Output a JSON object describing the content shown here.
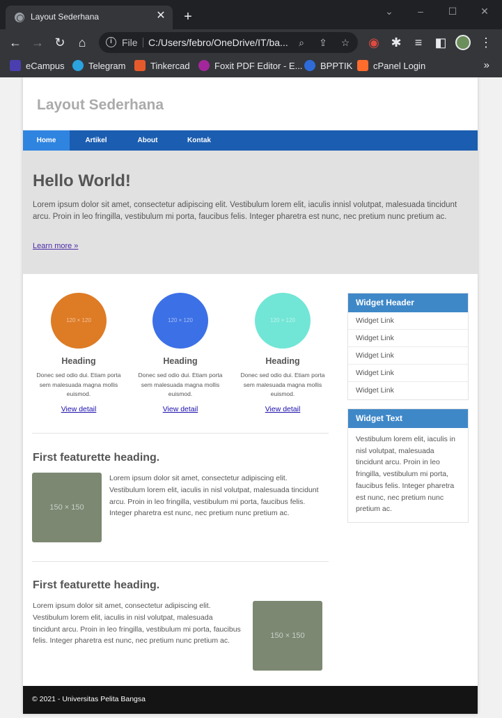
{
  "browser": {
    "tab_title": "Layout Sederhana",
    "new_tab": "+",
    "tab_close": "✕",
    "omnibox": {
      "scheme_label": "File",
      "url": "C:/Users/febro/OneDrive/IT/ba..."
    },
    "bookmarks": [
      {
        "label": "eCampus",
        "color": "#4b3fb0"
      },
      {
        "label": "Telegram",
        "color": "#2aa3de"
      },
      {
        "label": "Tinkercad",
        "color": "#e55a2b"
      },
      {
        "label": "Foxit PDF Editor - E...",
        "color": "#a3279b"
      },
      {
        "label": "BPPTIK",
        "color": "#2f6bd8"
      },
      {
        "label": "cPanel Login",
        "color": "#ff6c2c"
      }
    ],
    "bookmarks_more": "»"
  },
  "site": {
    "title": "Layout Sederhana",
    "nav": [
      "Home",
      "Artikel",
      "About",
      "Kontak"
    ]
  },
  "hero": {
    "title": "Hello World!",
    "text": "Lorem ipsum dolor sit amet, consectetur adipiscing elit. Vestibulum lorem elit, iaculis innisl volutpat, malesuada tincidunt arcu. Proin in leo fringilla, vestibulum mi porta, faucibus felis. Integer pharetra est nunc, nec pretium nunc pretium ac.",
    "link": "Learn more »"
  },
  "cards": [
    {
      "placeholder": "120 × 120",
      "color": "#de7b25",
      "heading": "Heading",
      "text": "Donec sed odio dui. Etiam porta sem malesuada magna mollis euismod.",
      "link": "View detail"
    },
    {
      "placeholder": "120 × 120",
      "color": "#3c70e6",
      "heading": "Heading",
      "text": "Donec sed odio dui. Etiam porta sem malesuada magna mollis euismod.",
      "link": "View detail"
    },
    {
      "placeholder": "120 × 120",
      "color": "#71e6d6",
      "heading": "Heading",
      "text": "Donec sed odio dui. Etiam porta sem malesuada magna mollis euismod.",
      "link": "View detail"
    }
  ],
  "featurettes": [
    {
      "heading": "First featurette heading.",
      "image": "150 × 150",
      "text": "Lorem ipsum dolor sit amet, consectetur adipiscing elit. Vestibulum lorem elit, iaculis in nisl volutpat, malesuada tincidunt arcu. Proin in leo fringilla, vestibulum mi porta, faucibus felis. Integer pharetra est nunc, nec pretium nunc pretium ac."
    },
    {
      "heading": "First featurette heading.",
      "image": "150 × 150",
      "text": "Lorem ipsum dolor sit amet, consectetur adipiscing elit. Vestibulum lorem elit, iaculis in nisl volutpat, malesuada tincidunt arcu. Proin in leo fringilla, vestibulum mi porta, faucibus felis. Integer pharetra est nunc, nec pretium nunc pretium ac."
    }
  ],
  "widgets": {
    "links_header": "Widget Header",
    "links": [
      "Widget Link",
      "Widget Link",
      "Widget Link",
      "Widget Link",
      "Widget Link"
    ],
    "text_header": "Widget Text",
    "text": "Vestibulum lorem elit, iaculis in nisl volutpat, malesuada tincidunt arcu. Proin in leo fringilla, vestibulum mi porta, faucibus felis. Integer pharetra est nunc, nec pretium nunc pretium ac."
  },
  "footer": {
    "text": "© 2021 - Universitas Pelita Bangsa"
  },
  "colors": {
    "nav_bg": "#1b5db0",
    "nav_active": "#2f84e0",
    "widget_header": "#3f88c8",
    "footer_bg": "#141414"
  }
}
